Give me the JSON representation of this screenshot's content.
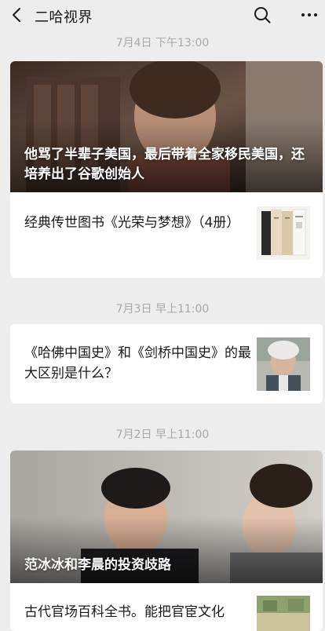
{
  "header": {
    "title": "二哈视界"
  },
  "sections": [
    {
      "date": "7月4日 下午13:00",
      "cover_title": "他骂了半辈子美国，最后带着全家移民美国，还培养出了谷歌创始人",
      "items": [
        {
          "title": "经典传世图书《光荣与梦想》（4册）"
        }
      ]
    },
    {
      "date": "7月3日 早上11:00",
      "items": [
        {
          "title": "《哈佛中国史》和《剑桥中国史》的最大区别是什么？"
        }
      ]
    },
    {
      "date": "7月2日 早上11:00",
      "cover_title": "范冰冰和李晨的投资歧路",
      "items": [
        {
          "title": "古代官场百科全书。能把官宦文化"
        }
      ]
    }
  ]
}
